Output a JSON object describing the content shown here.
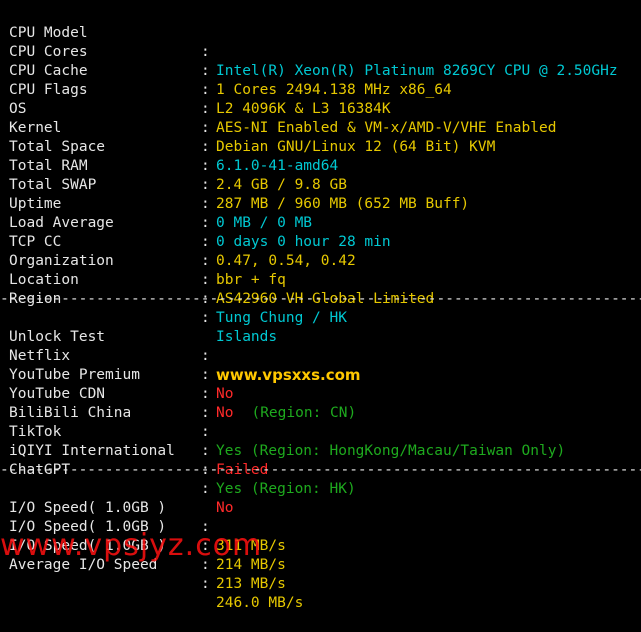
{
  "colors": {
    "label": "#e6e6e6",
    "cyan": "#00c8d2",
    "yellow": "#e6c800",
    "red": "#ff2a2a",
    "green": "#1eaa1e",
    "watermark_top": "#ffc800",
    "watermark_bottom": "#ff1111"
  },
  "separator": "----------------------------------------------------------------------------------------------------",
  "colon": ":",
  "system_info": [
    {
      "label": "CPU Model",
      "value": "Intel(R) Xeon(R) Platinum 8269CY CPU @ 2.50GHz",
      "color": "cyan"
    },
    {
      "label": "CPU Cores",
      "value": "1 Cores 2494.138 MHz x86_64",
      "color": "yellow"
    },
    {
      "label": "CPU Cache",
      "value": "L2 4096K & L3 16384K",
      "color": "yellow"
    },
    {
      "label": "CPU Flags",
      "value": "AES-NI Enabled & VM-x/AMD-V/VHE Enabled",
      "color": "yellow"
    },
    {
      "label": "OS",
      "value": "Debian GNU/Linux 12 (64 Bit) KVM",
      "color": "yellow"
    },
    {
      "label": "Kernel",
      "value": "6.1.0-41-amd64",
      "color": "cyan"
    },
    {
      "label": "Total Space",
      "value": "2.4 GB / 9.8 GB",
      "color": "yellow"
    },
    {
      "label": "Total RAM",
      "value": "287 MB / 960 MB (652 MB Buff)",
      "color": "yellow"
    },
    {
      "label": "Total SWAP",
      "value": "0 MB / 0 MB",
      "color": "cyan"
    },
    {
      "label": "Uptime",
      "value": "0 days 0 hour 28 min",
      "color": "cyan"
    },
    {
      "label": "Load Average",
      "value": "0.47, 0.54, 0.42",
      "color": "yellow"
    },
    {
      "label": "TCP CC",
      "value": "bbr + fq",
      "color": "yellow"
    },
    {
      "label": "Organization",
      "value": "AS42960 VH Global Limited",
      "color": "yellow"
    },
    {
      "label": "Location",
      "value": "Tung Chung / HK",
      "color": "cyan"
    },
    {
      "label": "Region",
      "value": "Islands",
      "color": "cyan"
    }
  ],
  "unlock_test": {
    "label": "Unlock Test",
    "watermark": "www.vpsxxs.com",
    "items": [
      {
        "label": "Netflix",
        "status": "No",
        "status_color": "red",
        "region": ""
      },
      {
        "label": "YouTube Premium",
        "status": "No",
        "status_color": "red",
        "region": "(Region: CN)"
      },
      {
        "label": "YouTube CDN",
        "status": "",
        "status_color": "red",
        "region": ""
      },
      {
        "label": "BiliBili China",
        "status": "Yes (Region: HongKong/Macau/Taiwan Only)",
        "status_color": "green",
        "region": ""
      },
      {
        "label": "TikTok",
        "status": "Failed",
        "status_color": "red",
        "region": ""
      },
      {
        "label": "iQIYI International",
        "status": "Yes (Region: HK)",
        "status_color": "green",
        "region": ""
      },
      {
        "label": "ChatGPT",
        "status": "No",
        "status_color": "red",
        "region": ""
      }
    ]
  },
  "io_speed": [
    {
      "label": "I/O Speed( 1.0GB )",
      "value": "311 MB/s"
    },
    {
      "label": "I/O Speed( 1.0GB )",
      "value": "214 MB/s"
    },
    {
      "label": "I/O Speed( 1.0GB )",
      "value": "213 MB/s"
    },
    {
      "label": "Average I/O Speed",
      "value": "246.0 MB/s"
    }
  ],
  "bottom_watermark": "www.vpsjyz.com"
}
